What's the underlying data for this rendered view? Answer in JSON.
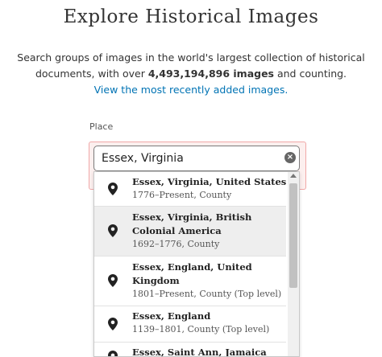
{
  "header": {
    "title": "Explore Historical Images",
    "intro_line1": "Search groups of images in the world's largest collection of historical",
    "intro_line2_prefix": "documents, with over ",
    "image_count": "4,493,194,896 images",
    "intro_line2_suffix": " and counting.",
    "recent_link": "View the most recently added images."
  },
  "search": {
    "label": "Place",
    "value": "Essex, Virginia",
    "clear_icon": "clear-circle-icon",
    "clear_glyph": "×"
  },
  "dropdown": {
    "options": [
      {
        "name": "Essex, Virginia, United States",
        "meta": "1776–Present, County",
        "icon": "map-pin-icon"
      },
      {
        "name": "Essex, Virginia, British Colonial America",
        "meta": "1692–1776, County",
        "icon": "map-pin-icon"
      },
      {
        "name": "Essex, England, United Kingdom",
        "meta": "1801–Present, County (Top level)",
        "icon": "map-pin-icon"
      },
      {
        "name": "Essex, England",
        "meta": "1139–1801, County (Top level)",
        "icon": "map-pin-icon"
      },
      {
        "name": "Essex, Saint Ann, Jamaica",
        "meta": "",
        "icon": "map-pin-icon"
      }
    ]
  },
  "colors": {
    "link": "#0073b4",
    "error_background": "#fcefee",
    "error_border": "#f0a8a8",
    "highlight_row": "#eeeeee"
  }
}
